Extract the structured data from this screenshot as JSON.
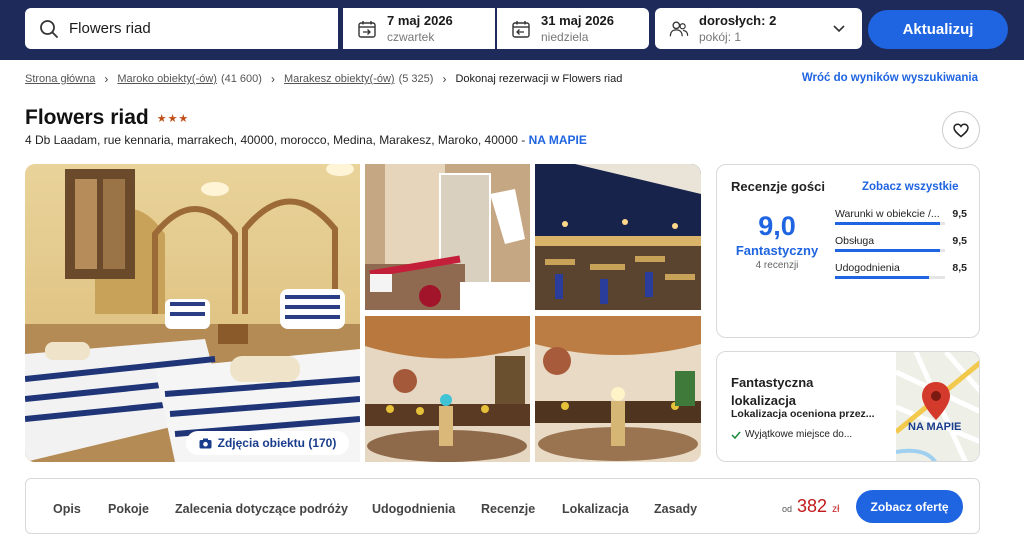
{
  "search": {
    "destination": "Flowers riad",
    "checkin_date": "7 maj 2026",
    "checkin_day": "czwartek",
    "checkout_date": "31 maj 2026",
    "checkout_day": "niedziela",
    "guests": "dorosłych: 2",
    "rooms": "pokój: 1",
    "update_label": "Aktualizuj"
  },
  "breadcrumb": {
    "items": [
      {
        "label": "Strona główna",
        "count": ""
      },
      {
        "label": "Maroko obiekty(-ów)",
        "count": "(41 600)"
      },
      {
        "label": "Marakesz obiekty(-ów)",
        "count": "(5 325)"
      }
    ],
    "current": "Dokonaj rezerwacji w Flowers riad",
    "back_label": "Wróć do wyników wyszukiwania"
  },
  "hotel": {
    "name": "Flowers riad",
    "stars": "★★★",
    "star_count": 3,
    "address": "4 Db Laadam, rue kennaria, marrakech, 40000, morocco, Medina, Marakesz, Maroko, 40000",
    "map_link": "NA MAPIE"
  },
  "gallery": {
    "photos_button": "Zdjęcia obiektu (170)"
  },
  "reviews": {
    "heading": "Recenzje gości",
    "see_all": "Zobacz wszystkie",
    "score": "9,0",
    "score_label": "Fantastyczny",
    "count": "4 recenzji",
    "categories": [
      {
        "name": "Warunki w obiekcie /...",
        "value": "9,5",
        "fraction": 0.95
      },
      {
        "name": "Obsługa",
        "value": "9,5",
        "fraction": 0.95
      },
      {
        "name": "Udogodnienia",
        "value": "8,5",
        "fraction": 0.85
      }
    ]
  },
  "location": {
    "heading": "Fantastyczna lokalizacja",
    "subtitle": "Lokalizacja oceniona przez...",
    "point": "Wyjątkowe miejsce do...",
    "map_label": "NA MAPIE"
  },
  "nav": {
    "tabs": [
      "Opis",
      "Pokoje",
      "Zalecenia dotyczące podróży",
      "Udogodnienia",
      "Recenzje",
      "Lokalizacja",
      "Zasady"
    ],
    "price_prefix": "od",
    "price": "382",
    "currency": "zł",
    "offer_label": "Zobacz ofertę"
  },
  "colors": {
    "header_bg": "#1e2a5a",
    "accent": "#1f64e0",
    "price": "#c21a1a",
    "stars": "#c0501a"
  }
}
